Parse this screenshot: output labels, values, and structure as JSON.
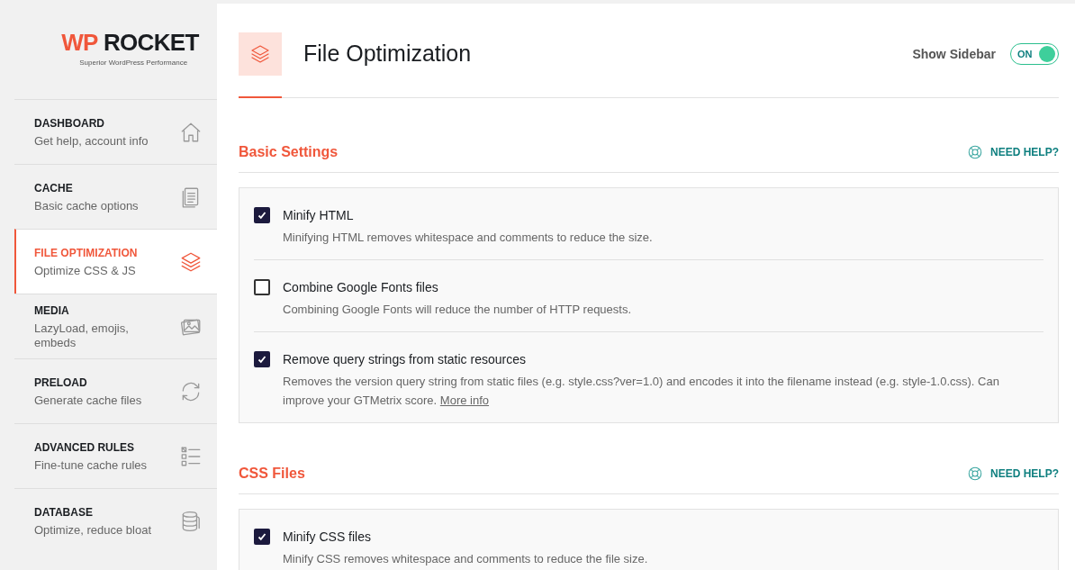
{
  "logo": {
    "name_accent": "WP",
    "name": "ROCKET",
    "tagline": "Superior WordPress Performance"
  },
  "sidebar": {
    "items": [
      {
        "title": "DASHBOARD",
        "subtitle": "Get help, account info",
        "selected": false
      },
      {
        "title": "CACHE",
        "subtitle": "Basic cache options",
        "selected": false
      },
      {
        "title": "FILE OPTIMIZATION",
        "subtitle": "Optimize CSS & JS",
        "selected": true
      },
      {
        "title": "MEDIA",
        "subtitle": "LazyLoad, emojis, embeds",
        "selected": false
      },
      {
        "title": "PRELOAD",
        "subtitle": "Generate cache files",
        "selected": false
      },
      {
        "title": "ADVANCED RULES",
        "subtitle": "Fine-tune cache rules",
        "selected": false
      },
      {
        "title": "DATABASE",
        "subtitle": "Optimize, reduce bloat",
        "selected": false
      }
    ]
  },
  "header": {
    "title": "File Optimization",
    "sidebar_toggle": {
      "label": "Show Sidebar",
      "state": "ON",
      "on": true
    }
  },
  "sections": [
    {
      "title": "Basic Settings",
      "help": "NEED HELP?",
      "options": [
        {
          "label": "Minify HTML",
          "description": "Minifying HTML removes whitespace and comments to reduce the size.",
          "checked": true
        },
        {
          "label": "Combine Google Fonts files",
          "description": "Combining Google Fonts will reduce the number of HTTP requests.",
          "checked": false
        },
        {
          "label": "Remove query strings from static resources",
          "description": "Removes the version query string from static files (e.g. style.css?ver=1.0) and encodes it into the filename instead (e.g. style-1.0.css). Can improve your GTMetrix score.",
          "link": "More info",
          "checked": true
        }
      ]
    },
    {
      "title": "CSS Files",
      "help": "NEED HELP?",
      "options": [
        {
          "label": "Minify CSS files",
          "description": "Minify CSS removes whitespace and comments to reduce the file size.",
          "checked": true
        }
      ]
    }
  ]
}
